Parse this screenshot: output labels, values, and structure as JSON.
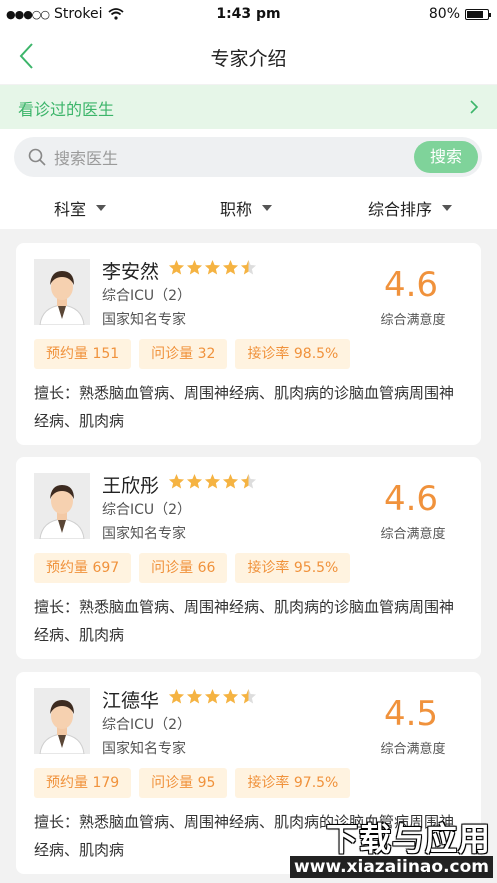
{
  "status": {
    "carrier": "Strokei",
    "time": "1:43 pm",
    "battery": "80%"
  },
  "nav": {
    "title": "专家介绍"
  },
  "visited": {
    "label": "看诊过的医生"
  },
  "search": {
    "placeholder": "搜索医生",
    "button": "搜索"
  },
  "filters": [
    "科室",
    "职称",
    "综合排序"
  ],
  "doctors": [
    {
      "name": "李安然",
      "rating": 4.5,
      "dept": "综合ICU（2）",
      "title": "国家知名专家",
      "score": "4.6",
      "score_label": "综合满意度",
      "tags": [
        "预约量 151",
        "问诊量 32",
        "接诊率 98.5%"
      ],
      "desc": "擅长：熟悉脑血管病、周围神经病、肌肉病的诊脑血管病周围神经病、肌肉病"
    },
    {
      "name": "王欣彤",
      "rating": 4.5,
      "dept": "综合ICU（2）",
      "title": "国家知名专家",
      "score": "4.6",
      "score_label": "综合满意度",
      "tags": [
        "预约量 697",
        "问诊量 66",
        "接诊率 95.5%"
      ],
      "desc": "擅长：熟悉脑血管病、周围神经病、肌肉病的诊脑血管病周围神经病、肌肉病"
    },
    {
      "name": "江德华",
      "rating": 4.5,
      "dept": "综合ICU（2）",
      "title": "国家知名专家",
      "score": "4.5",
      "score_label": "综合满意度",
      "tags": [
        "预约量 179",
        "问诊量 95",
        "接诊率 97.5%"
      ],
      "desc": "擅长：熟悉脑血管病、周围神经病、肌肉病的诊脑血管病周围神经病、肌肉病"
    }
  ],
  "watermark": {
    "line1": "下载与应用",
    "line2": "www.xiazaiinao.com"
  },
  "colors": {
    "accent_green": "#3cb56a",
    "button_green": "#7fd39a",
    "orange": "#f0923c",
    "star": "#f5b342"
  }
}
